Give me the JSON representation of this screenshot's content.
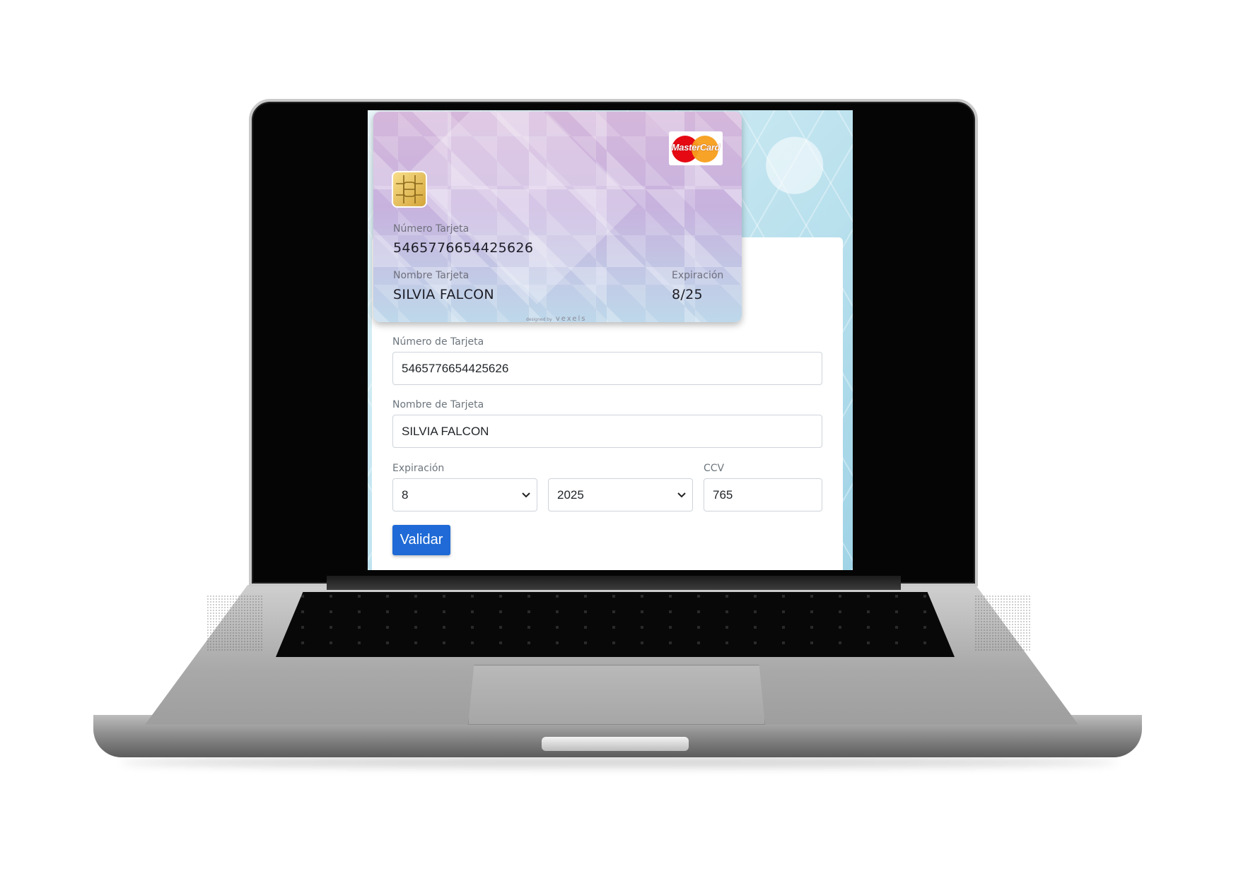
{
  "card": {
    "brand": "MasterCard",
    "number_label": "Número Tarjeta",
    "number": "5465776654425626",
    "name_label": "Nombre Tarjeta",
    "name": "SILVIA FALCON",
    "expiry_label": "Expiración",
    "expiry": "8/25",
    "watermark": "vexels",
    "watermark_prefix": "designed by"
  },
  "form": {
    "number_label": "Número de Tarjeta",
    "number_value": "5465776654425626",
    "name_label": "Nombre de Tarjeta",
    "name_value": "SILVIA FALCON",
    "expiry_label": "Expiración",
    "month_value": "8",
    "year_value": "2025",
    "ccv_label": "CCV",
    "ccv_value": "765",
    "submit_label": "Validar"
  },
  "colors": {
    "button": "#1f6ad6",
    "card_top": "#d5b7db",
    "card_bottom": "#bed8ea",
    "mastercard_red": "#e50914",
    "mastercard_orange": "#f79e1b"
  },
  "icons": {
    "chip": "chip-icon",
    "select_arrow": "chevron-down-icon"
  }
}
